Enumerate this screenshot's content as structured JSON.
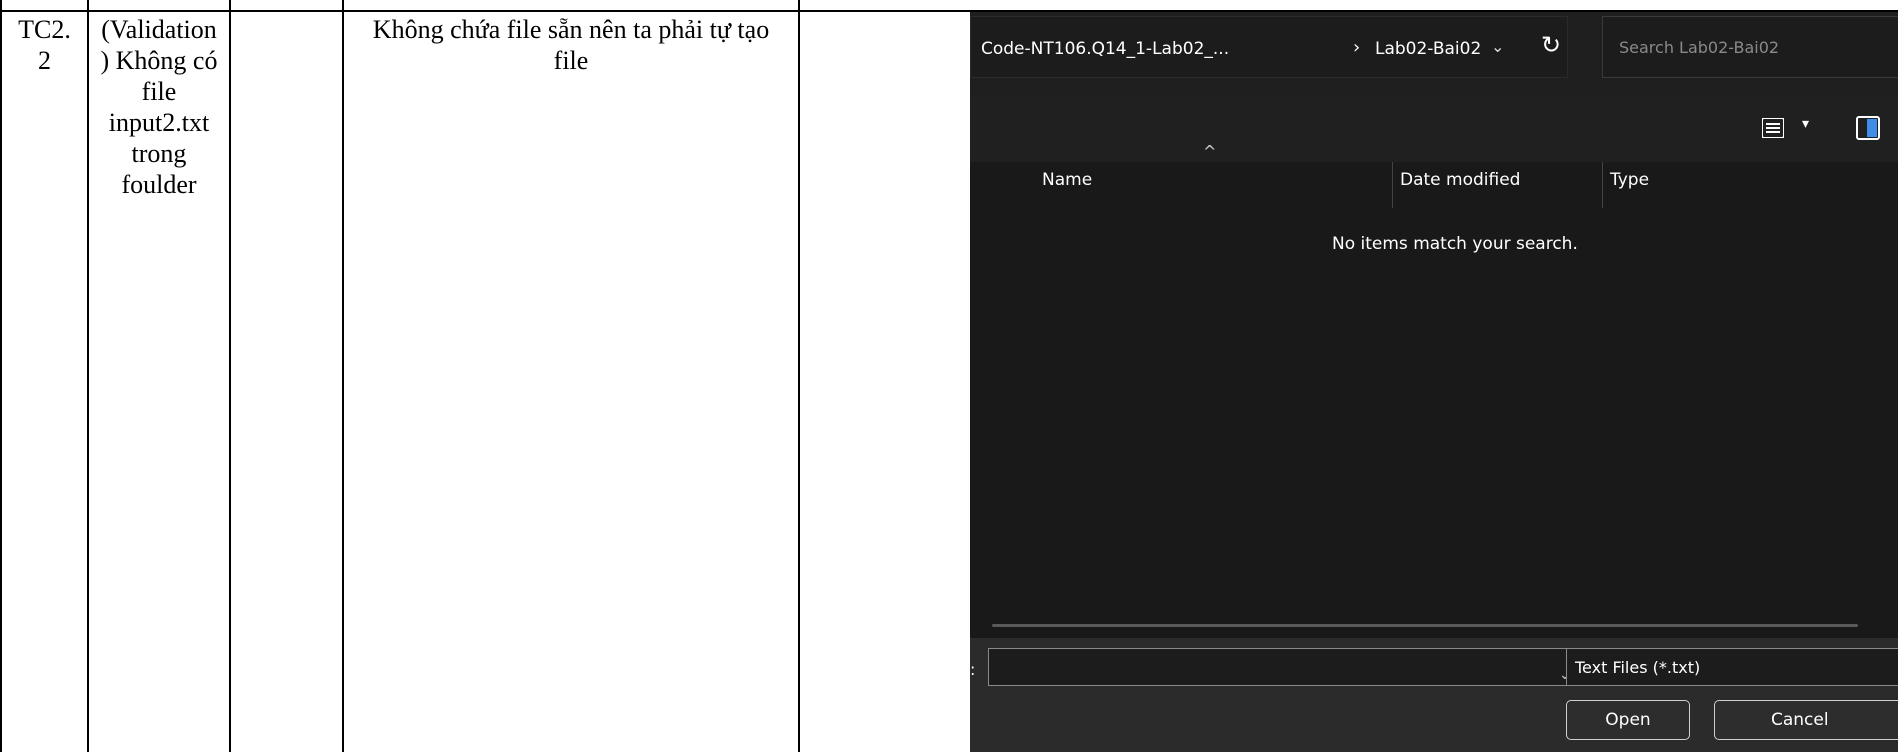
{
  "row": {
    "id": "TC2.\n2",
    "description": "(Validation\n) Không có\nfile\ninput2.txt\ntrong\nfoulder",
    "expected": "Không chứa file sẵn nên ta phải tự tạo\nfile"
  },
  "dialog": {
    "breadcrumb_parent": "Code-NT106.Q14_1-Lab02_...",
    "breadcrumb_separator": "›",
    "breadcrumb_current": "Lab02-Bai02",
    "refresh_icon": "refresh-icon",
    "search_placeholder": "Search Lab02-Bai02",
    "columns": [
      "Name",
      "Date modified",
      "Type"
    ],
    "empty_message": "No items match your search.",
    "filename_label": ":",
    "filename_value": "",
    "file_type": "Text Files (*.txt)",
    "open_label": "Open",
    "cancel_label": "Cancel"
  }
}
